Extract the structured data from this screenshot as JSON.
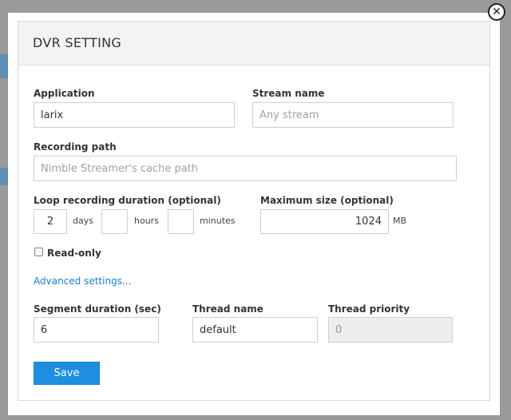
{
  "dialog": {
    "title": "DVR SETTING",
    "close_glyph": "✕"
  },
  "application": {
    "label": "Application",
    "value": "larix"
  },
  "stream_name": {
    "label": "Stream name",
    "value": "",
    "placeholder": "Any stream"
  },
  "recording_path": {
    "label": "Recording path",
    "value": "",
    "placeholder": "Nimble Streamer's cache path"
  },
  "loop": {
    "label": "Loop recording duration (optional)",
    "days_value": "2",
    "days_unit": "days",
    "hours_value": "",
    "hours_unit": "hours",
    "minutes_value": "",
    "minutes_unit": "minutes"
  },
  "max_size": {
    "label": "Maximum size (optional)",
    "value": "1024",
    "unit": "MB"
  },
  "read_only": {
    "label": "Read-only",
    "checked": false
  },
  "advanced_link": "Advanced settings...",
  "segment_duration": {
    "label": "Segment duration (sec)",
    "value": "6"
  },
  "thread_name": {
    "label": "Thread name",
    "value": "default"
  },
  "thread_priority": {
    "label": "Thread priority",
    "value": "0"
  },
  "save_label": "Save",
  "colors": {
    "accent": "#1e8fe0",
    "link": "#1a82c8"
  }
}
